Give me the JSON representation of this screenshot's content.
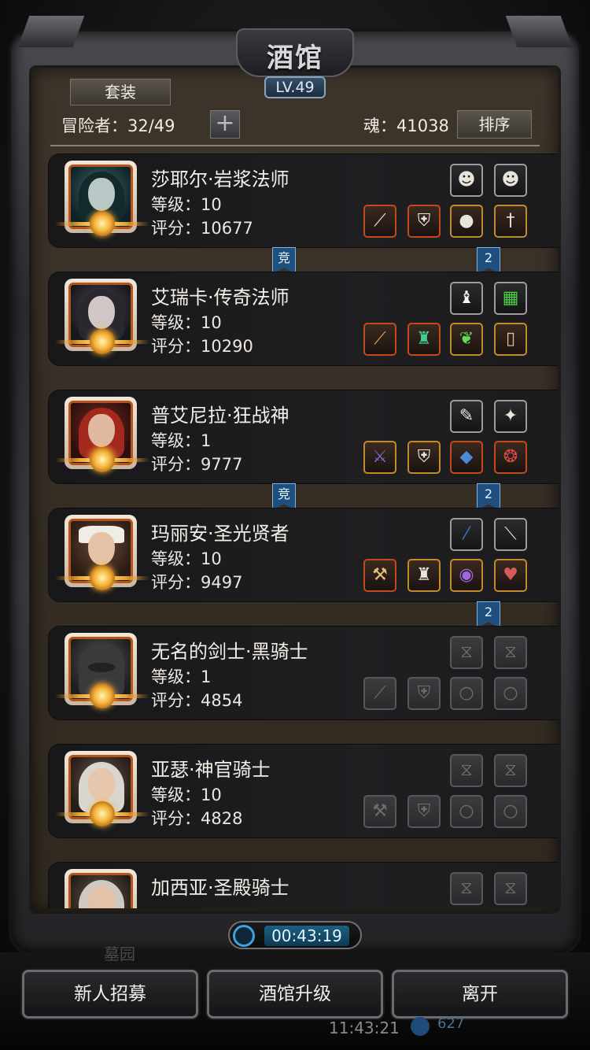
{
  "header": {
    "title": "酒馆",
    "level": "LV.49"
  },
  "toolbar": {
    "suit_label": "套装",
    "adventurers": "冒险者：32/49",
    "add_label": "+",
    "soul": "魂：41038",
    "sort_label": "排序"
  },
  "heroes": [
    {
      "name": "莎耶尔·岩浆法师",
      "level": "等级：10",
      "score": "评分：10677"
    },
    {
      "name": "艾瑞卡·传奇法师",
      "level": "等级：10",
      "score": "评分：10290"
    },
    {
      "name": "普艾尼拉·狂战神",
      "level": "等级：1",
      "score": "评分：9777"
    },
    {
      "name": "玛丽安·圣光贤者",
      "level": "等级：10",
      "score": "评分：9497"
    },
    {
      "name": "无名的剑士·黑骑士",
      "level": "等级：1",
      "score": "评分：4854"
    },
    {
      "name": "亚瑟·神官骑士",
      "level": "等级：10",
      "score": "评分：4828"
    },
    {
      "name": "加西亚·圣殿骑士",
      "level": "",
      "score": ""
    }
  ],
  "tags": {
    "jing": "竞",
    "two": "2"
  },
  "timer": "00:43:19",
  "bottom": {
    "recruit_label": "新人招募",
    "upgrade_label": "酒馆升级",
    "leave_label": "离开",
    "clock": "11:43:21",
    "gem_value": "627",
    "faded_label": "墓园"
  }
}
